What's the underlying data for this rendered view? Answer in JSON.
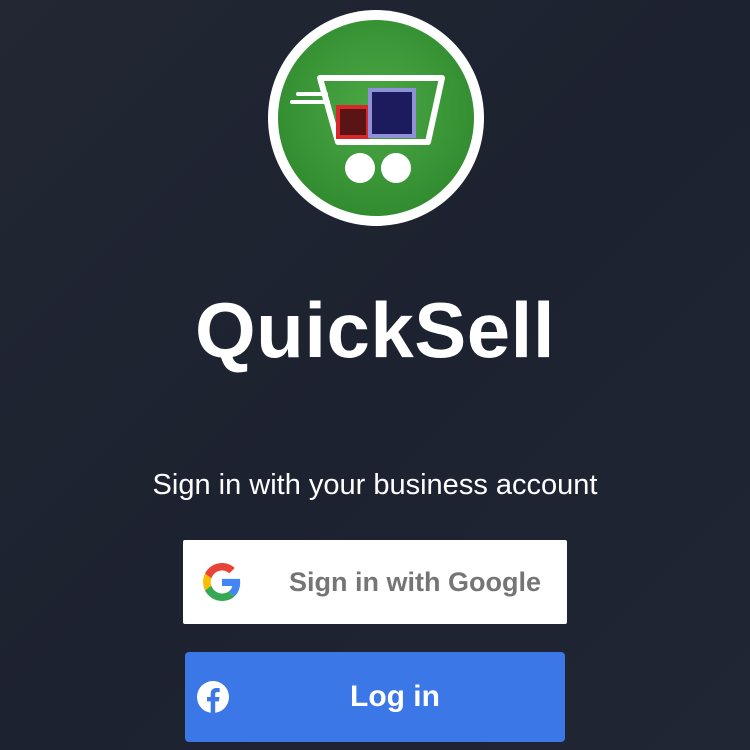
{
  "app": {
    "title": "QuickSell",
    "subtitle": "Sign in with your business account"
  },
  "logo": {
    "icon": "shopping-cart-logo",
    "ring_color": "#ffffff",
    "bg_color": "#3f9a3a",
    "box_small_color": "#5a1416",
    "box_large_color": "#1b1b5e"
  },
  "google_button": {
    "label": "Sign in with Google",
    "icon": "google-g-icon"
  },
  "facebook_button": {
    "label": "Log in",
    "icon": "facebook-icon",
    "color": "#3b77e7"
  }
}
